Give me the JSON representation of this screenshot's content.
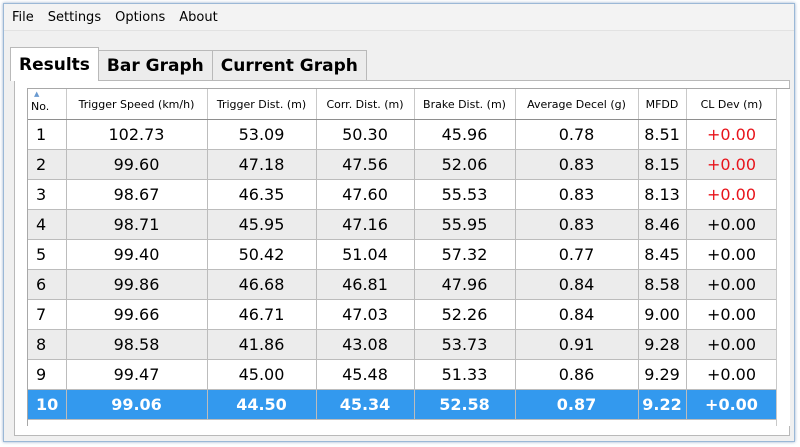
{
  "menu": [
    "File",
    "Settings",
    "Options",
    "About"
  ],
  "tabs": [
    {
      "label": "Results",
      "active": true
    },
    {
      "label": "Bar Graph",
      "active": false
    },
    {
      "label": "Current Graph",
      "active": false
    }
  ],
  "table": {
    "columns": [
      "No.",
      "Trigger Speed (km/h)",
      "Trigger Dist. (m)",
      "Corr. Dist. (m)",
      "Brake Dist. (m)",
      "Average Decel (g)",
      "MFDD",
      "CL Dev (m)"
    ],
    "rows": [
      [
        "1",
        "102.73",
        "53.09",
        "50.30",
        "45.96",
        "0.78",
        "8.51",
        "+0.00"
      ],
      [
        "2",
        "99.60",
        "47.18",
        "47.56",
        "52.06",
        "0.83",
        "8.15",
        "+0.00"
      ],
      [
        "3",
        "98.67",
        "46.35",
        "47.60",
        "55.53",
        "0.83",
        "8.13",
        "+0.00"
      ],
      [
        "4",
        "98.71",
        "45.95",
        "47.16",
        "55.95",
        "0.83",
        "8.46",
        "+0.00"
      ],
      [
        "5",
        "99.40",
        "50.42",
        "51.04",
        "57.32",
        "0.77",
        "8.45",
        "+0.00"
      ],
      [
        "6",
        "99.86",
        "46.68",
        "46.81",
        "47.96",
        "0.84",
        "8.58",
        "+0.00"
      ],
      [
        "7",
        "99.66",
        "46.71",
        "47.03",
        "52.26",
        "0.84",
        "9.00",
        "+0.00"
      ],
      [
        "8",
        "98.58",
        "41.86",
        "43.08",
        "53.73",
        "0.91",
        "9.28",
        "+0.00"
      ],
      [
        "9",
        "99.47",
        "45.00",
        "45.48",
        "51.33",
        "0.86",
        "9.29",
        "+0.00"
      ],
      [
        "10",
        "99.06",
        "44.50",
        "45.34",
        "52.58",
        "0.87",
        "9.22",
        "+0.00"
      ]
    ],
    "red_cl_dev_rows": [
      0,
      1,
      2
    ],
    "selected_row": 9
  },
  "colors": {
    "selected_row": "#3399ee",
    "warning_text": "#e8141b",
    "alt_row": "#ececec"
  },
  "icons": {
    "sort": "sort-ascending-icon"
  }
}
